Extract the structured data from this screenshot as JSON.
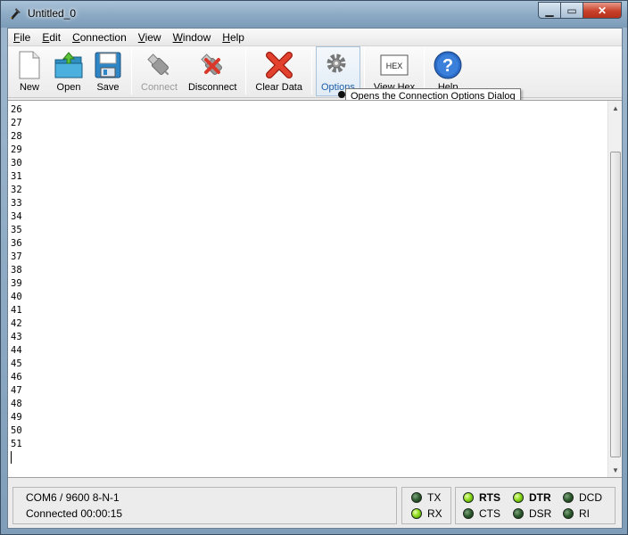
{
  "window": {
    "title": "Untitled_0",
    "controls": {
      "minimize": "▁",
      "maximize": "▭",
      "close": "✕"
    }
  },
  "menu": [
    {
      "mnemonic": "F",
      "rest": "ile"
    },
    {
      "mnemonic": "E",
      "rest": "dit"
    },
    {
      "mnemonic": "C",
      "rest": "onnection"
    },
    {
      "mnemonic": "V",
      "rest": "iew"
    },
    {
      "mnemonic": "W",
      "rest": "indow"
    },
    {
      "mnemonic": "H",
      "rest": "elp"
    }
  ],
  "toolbar": {
    "new": "New",
    "open": "Open",
    "save": "Save",
    "connect": "Connect",
    "disconnect": "Disconnect",
    "clear_data": "Clear Data",
    "options": "Options",
    "view_hex": "View Hex",
    "hex_icon_text": "HEX",
    "help": "Help",
    "tooltip": "Opens the Connection Options Dialog"
  },
  "terminal": {
    "lines": [
      "26",
      "27",
      "28",
      "29",
      "30",
      "31",
      "32",
      "33",
      "34",
      "35",
      "36",
      "37",
      "38",
      "39",
      "40",
      "41",
      "42",
      "43",
      "44",
      "45",
      "46",
      "47",
      "48",
      "49",
      "50",
      "51"
    ]
  },
  "status": {
    "port": "COM6 / 9600 8-N-1",
    "connection": "Connected 00:00:15",
    "tx": "TX",
    "rx": "RX",
    "rts": "RTS",
    "cts": "CTS",
    "dtr": "DTR",
    "dsr": "DSR",
    "dcd": "DCD",
    "ri": "RI"
  },
  "colors": {
    "led_on": "#8fdc1c",
    "led_off": "#2d5a2d",
    "accent": "#1d5ea8"
  }
}
